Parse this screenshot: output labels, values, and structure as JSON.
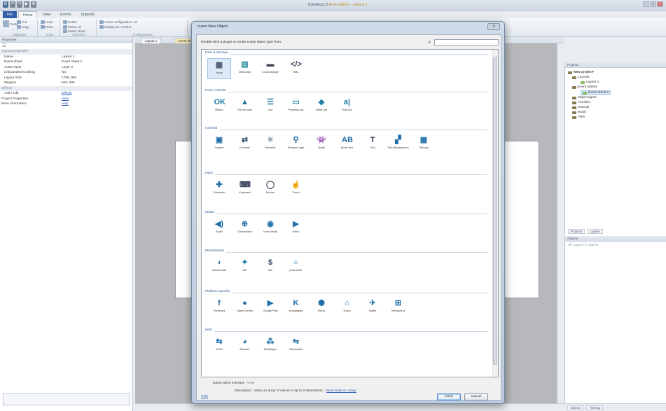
{
  "app": {
    "title": "Construct 2 ",
    "title_suffix": "Free edition - Layout 1"
  },
  "ribbon": {
    "tabs": [
      "File",
      "Home",
      "View",
      "Events",
      "Upgrade"
    ],
    "buttons": {
      "cut": "Cut",
      "copy": "Copy",
      "paste": "Paste",
      "undo": "Undo",
      "redo": "Redo",
      "delete": "Delete",
      "select_all": "Select All",
      "select_none": "Select None",
      "config1": "Active configuration: All",
      "config2": "Display as: HTML5"
    },
    "groups": [
      "Clipboard",
      "Undo",
      "Selection",
      "Configurations"
    ]
  },
  "properties": {
    "header": "Properties",
    "category": "Layout properties",
    "rows": [
      {
        "key": "Name",
        "value": "Layout 1"
      },
      {
        "key": "Event sheet",
        "value": "Event sheet 1"
      },
      {
        "key": "Active layer",
        "value": "Layer 0"
      },
      {
        "key": "Unbounded scrolling",
        "value": "No"
      },
      {
        "key": "Layout Size",
        "value": "1708, 960"
      },
      {
        "key": "Margins",
        "value": "500, 500"
      }
    ],
    "effects_category": "Effects",
    "effects_row": {
      "key": "Add / edit",
      "value": "Effects"
    },
    "project_row": {
      "key": "Project Properties",
      "value": "View"
    },
    "more_row": {
      "key": "More information",
      "value": "Help"
    }
  },
  "doc_tabs": [
    "Layout 1",
    "Event sheet 1"
  ],
  "projects_panel": {
    "header": "Projects",
    "root": "New project*",
    "items": [
      "Layouts",
      "Layout 1",
      "Event sheets",
      "Event sheet 1",
      "Object types",
      "Families",
      "Sounds",
      "Music",
      "Files"
    ],
    "tabs": [
      "Projects",
      "Layers"
    ],
    "objects_header": "Objects",
    "objects_hint": "All 'Layout 1' objects",
    "bottom_tabs": [
      "Objects",
      "Tilemap"
    ]
  },
  "dialog": {
    "title": "Insert New Object",
    "hint": "Double-click a plugin to create a new object type from:",
    "search_value": "",
    "name_label": "Name when inserted:",
    "name_value": "Array",
    "desc_label": "Description:",
    "desc_value": "Store an array of values in up to 3 dimensions.",
    "desc_link": "More help on 'Array'",
    "help": "Help",
    "insert": "Insert",
    "cancel": "Cancel",
    "categories": [
      {
        "name": "Data & Storage",
        "plugins": [
          {
            "label": "Array",
            "icon": "array-icon",
            "color": "#4a5a70"
          },
          {
            "label": "Dictionary",
            "icon": "dictionary-icon",
            "color": "#2a8a9a"
          },
          {
            "label": "Local storage",
            "icon": "local-storage-icon",
            "color": "#3a4050"
          },
          {
            "label": "XML",
            "icon": "xml-icon",
            "color": "#3b4660"
          }
        ]
      },
      {
        "name": "Form controls",
        "plugins": [
          {
            "label": "Button",
            "icon": "button-icon",
            "color": "#1f7fa8"
          },
          {
            "label": "File chooser",
            "icon": "file-chooser-icon",
            "color": "#1f6fa8"
          },
          {
            "label": "List",
            "icon": "list-icon",
            "color": "#1f7fa8"
          },
          {
            "label": "Progress bar",
            "icon": "progress-bar-icon",
            "color": "#1f7fa8"
          },
          {
            "label": "Slider bar",
            "icon": "slider-bar-icon",
            "color": "#1f7fa8"
          },
          {
            "label": "Text box",
            "icon": "text-box-icon",
            "color": "#1f7fa8"
          }
        ]
      },
      {
        "name": "General",
        "plugins": [
          {
            "label": "9-patch",
            "icon": "nine-patch-icon",
            "color": "#1f6fa8"
          },
          {
            "label": "Function",
            "icon": "function-icon",
            "color": "#2a4d6e"
          },
          {
            "label": "Particles",
            "icon": "particles-icon",
            "color": "#8a9aa8"
          },
          {
            "label": "Shadow Light",
            "icon": "shadow-light-icon",
            "color": "#1f6fa8"
          },
          {
            "label": "Sprite",
            "icon": "sprite-icon",
            "color": "#1f6fa8"
          },
          {
            "label": "Sprite font",
            "icon": "sprite-font-icon",
            "color": "#1f6fa8"
          },
          {
            "label": "Text",
            "icon": "text-icon",
            "color": "#2a3a50"
          },
          {
            "label": "Tiled Background",
            "icon": "tiled-background-icon",
            "color": "#1f6fa8"
          },
          {
            "label": "Tilemap",
            "icon": "tilemap-icon",
            "color": "#1f6fa8"
          }
        ]
      },
      {
        "name": "Input",
        "plugins": [
          {
            "label": "Gamepad",
            "icon": "gamepad-icon",
            "color": "#1f6fa8"
          },
          {
            "label": "Keyboard",
            "icon": "keyboard-icon",
            "color": "#3a4a60"
          },
          {
            "label": "Mouse",
            "icon": "mouse-icon",
            "color": "#3a4a60"
          },
          {
            "label": "Touch",
            "icon": "touch-icon",
            "color": "#3a4a60"
          }
        ]
      },
      {
        "name": "Media",
        "plugins": [
          {
            "label": "Audio",
            "icon": "audio-icon",
            "color": "#1f6fa8"
          },
          {
            "label": "Geolocation",
            "icon": "geolocation-icon",
            "color": "#1f6fa8"
          },
          {
            "label": "User Media",
            "icon": "user-media-icon",
            "color": "#1f6fa8"
          },
          {
            "label": "Video",
            "icon": "video-icon",
            "color": "#1f6fa8"
          }
        ]
      },
      {
        "name": "Monetisation",
        "plugins": [
          {
            "label": "Admob Ads",
            "icon": "admob-icon",
            "color": "#1f7fa8"
          },
          {
            "label": "IAP",
            "icon": "iap-icon",
            "color": "#1f7fa8"
          },
          {
            "label": "IAP",
            "icon": "dollar-icon",
            "color": "#3a4a60"
          },
          {
            "label": "pubCenter",
            "icon": "pubcenter-icon",
            "color": "#1f6fa8"
          }
        ]
      },
      {
        "name": "Platform specific",
        "plugins": [
          {
            "label": "Facebook",
            "icon": "facebook-icon",
            "color": "#1f6fa8"
          },
          {
            "label": "Game Center",
            "icon": "game-center-icon",
            "color": "#1f6fa8"
          },
          {
            "label": "Google Play",
            "icon": "google-play-icon",
            "color": "#1f6fa8"
          },
          {
            "label": "Kongregate",
            "icon": "kongregate-icon",
            "color": "#1f6fa8"
          },
          {
            "label": "NW.js",
            "icon": "nwjs-icon",
            "color": "#1f6fa8"
          },
          {
            "label": "Scirra",
            "icon": "scirra-icon",
            "color": "#1f6fa8"
          },
          {
            "label": "Twitter",
            "icon": "twitter-icon",
            "color": "#1f6fa8"
          },
          {
            "label": "Windows 8",
            "icon": "windows-icon",
            "color": "#1f6fa8"
          }
        ]
      },
      {
        "name": "Web",
        "plugins": [
          {
            "label": "AJAX",
            "icon": "ajax-icon",
            "color": "#1f6fa8"
          },
          {
            "label": "Browser",
            "icon": "browser-icon",
            "color": "#1f6fa8"
          },
          {
            "label": "Multiplayer",
            "icon": "multiplayer-icon",
            "color": "#1f6fa8"
          },
          {
            "label": "Websocket",
            "icon": "websocket-icon",
            "color": "#1f6fa8"
          }
        ]
      }
    ]
  }
}
